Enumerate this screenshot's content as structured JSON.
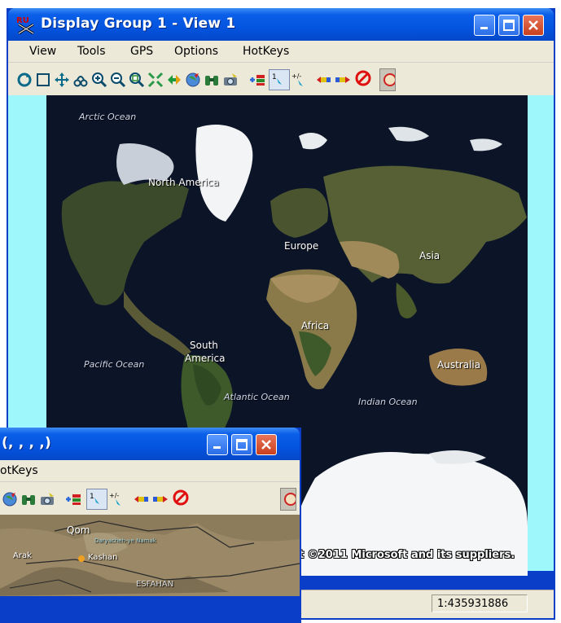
{
  "window_main": {
    "title": "Display Group 1 - View 1",
    "menu": [
      "View",
      "Tools",
      "GPS",
      "Options",
      "HotKeys"
    ],
    "map": {
      "labels": {
        "arctic_ocean": "Arctic Ocean",
        "north_america": "North America",
        "europe": "Europe",
        "asia": "Asia",
        "africa": "Africa",
        "south_america_1": "South",
        "south_america_2": "America",
        "pacific_ocean": "Pacific Ocean",
        "atlantic_ocean": "Atlantic Ocean",
        "indian_ocean": "Indian Ocean",
        "australia": "Australia"
      },
      "copyright": "t ©2011 Microsoft and its suppliers."
    },
    "status": {
      "scale": "1:435931886"
    }
  },
  "window_second": {
    "title_fragment": "(, , , ,)",
    "menu_fragment": "otKeys",
    "map": {
      "labels": {
        "qom": "Qom",
        "arak": "Arak",
        "kashan": "Kashan",
        "esfahan": "ESFAHAN",
        "lake": "Daryacheh-ye Namak"
      }
    }
  },
  "colors": {
    "title_bar": "#0454e0",
    "menu_bg": "#ece9d8",
    "view_bg": "#9ef8fb",
    "map_ocean": "#0d1426"
  }
}
